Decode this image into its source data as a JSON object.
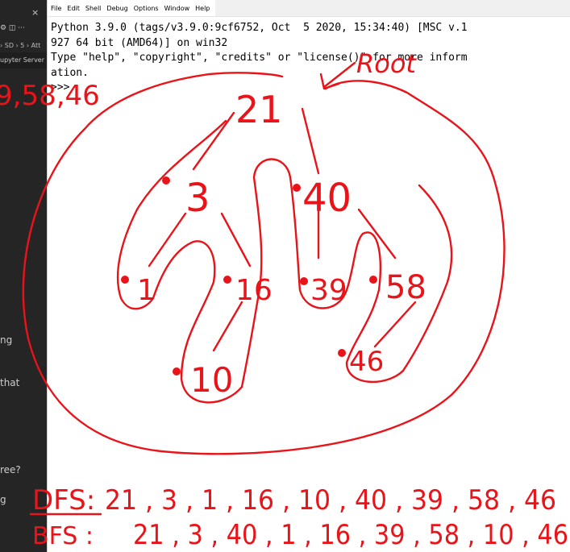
{
  "left_panel": {
    "close_glyph": "×",
    "icons_text": "⚙ ◫ ···",
    "breadcrumb": "› SD › 5 › Att",
    "tab_label": "upyter Server",
    "fragments": [
      "ng",
      "that",
      "ree?",
      "g"
    ]
  },
  "idle": {
    "menu": [
      "File",
      "Edit",
      "Shell",
      "Debug",
      "Options",
      "Window",
      "Help"
    ],
    "lines": [
      "Python 3.9.0 (tags/v3.9.0:9cf6752, Oct  5 2020, 15:34:40) [MSC v.1",
      "927 64 bit (AMD64)] on win32",
      "Type \"help\", \"copyright\", \"credits\" or \"license()\" for more inform",
      "ation.",
      ">>> "
    ]
  },
  "annotations": {
    "root_label": "Root",
    "top_left": "9,58,46",
    "nodes": [
      "21",
      "3",
      "40",
      "1",
      "16",
      "39",
      "58",
      "10",
      "46"
    ],
    "dfs_label": "DFS:",
    "dfs_sequence": "21 , 3 , 1 , 16 , 10 , 40 , 39 , 58 , 46",
    "bfs_label": "BFS :",
    "bfs_sequence": "21 , 3 , 40 , 1 , 16 , 39 , 58 , 10 , 46"
  },
  "colors": {
    "ink": "#e8141a",
    "editor_bg": "#1e1e1e",
    "idle_bg": "#ffffff"
  }
}
